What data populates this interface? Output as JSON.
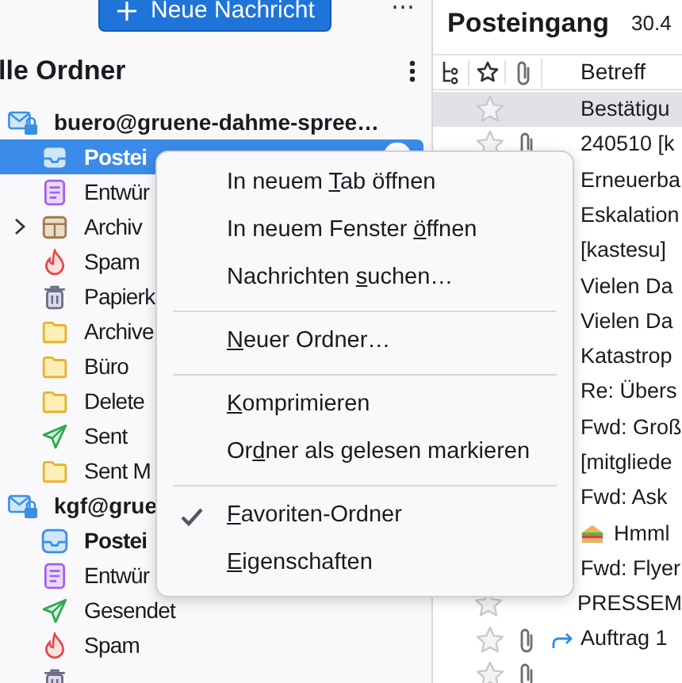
{
  "toolbar": {
    "new_message_button": "Neue Nachricht",
    "more_button": "⋯"
  },
  "folder_pane": {
    "title": "lle Ordner",
    "accounts": [
      {
        "name": "buero@gruene-dahme-spree…",
        "folders": [
          {
            "kind": "inbox",
            "name": "Postei",
            "selected": true,
            "bold": true,
            "expandable": false
          },
          {
            "kind": "drafts",
            "name": "Entwür",
            "selected": false,
            "bold": false,
            "expandable": false
          },
          {
            "kind": "archive",
            "name": "Archiv",
            "selected": false,
            "bold": false,
            "expandable": true
          },
          {
            "kind": "spam",
            "name": "Spam",
            "selected": false,
            "bold": false,
            "expandable": false
          },
          {
            "kind": "trash",
            "name": "Papierk",
            "selected": false,
            "bold": false,
            "expandable": false
          },
          {
            "kind": "folder",
            "name": "Archive",
            "selected": false,
            "bold": false,
            "expandable": false
          },
          {
            "kind": "folder",
            "name": "Büro",
            "selected": false,
            "bold": false,
            "expandable": false
          },
          {
            "kind": "folder",
            "name": "Delete",
            "selected": false,
            "bold": false,
            "expandable": false
          },
          {
            "kind": "sent",
            "name": "Sent",
            "selected": false,
            "bold": false,
            "expandable": false
          },
          {
            "kind": "folder",
            "name": "Sent M",
            "selected": false,
            "bold": false,
            "expandable": false
          }
        ]
      },
      {
        "name": "kgf@grue",
        "folders": [
          {
            "kind": "inbox",
            "name": "Postei",
            "selected": false,
            "bold": true,
            "expandable": false
          },
          {
            "kind": "drafts",
            "name": "Entwür",
            "selected": false,
            "bold": false,
            "expandable": false
          },
          {
            "kind": "sent",
            "name": "Gesendet",
            "selected": false,
            "bold": false,
            "expandable": false
          },
          {
            "kind": "spam",
            "name": "Spam",
            "selected": false,
            "bold": false,
            "expandable": false
          },
          {
            "kind": "trash",
            "selected": false
          }
        ]
      }
    ]
  },
  "message_list": {
    "title": "Posteingang",
    "count": "30.4",
    "columns": {
      "subject": "Betreff"
    },
    "rows": [
      {
        "subject": "Bestätigu",
        "selected": true,
        "attachment": false,
        "replied": false,
        "emoji": false
      },
      {
        "subject": "240510 [k",
        "selected": false,
        "attachment": true,
        "replied": false,
        "emoji": false
      },
      {
        "subject": "Erneuerba",
        "selected": false,
        "emoji": false
      },
      {
        "subject": "Eskalation",
        "selected": false,
        "emoji": false
      },
      {
        "subject": "[kastesu]",
        "selected": false,
        "emoji": false
      },
      {
        "subject": "Vielen Da",
        "selected": false,
        "emoji": false
      },
      {
        "subject": "Vielen Da",
        "selected": false,
        "emoji": false
      },
      {
        "subject": "Katastrop",
        "selected": false,
        "emoji": false
      },
      {
        "subject": "Re: Übers",
        "selected": false,
        "emoji": false
      },
      {
        "subject": "Fwd: Groß",
        "selected": false,
        "emoji": false
      },
      {
        "subject": "[mitgliede",
        "selected": false,
        "emoji": false
      },
      {
        "subject": "Fwd: Ask",
        "selected": false,
        "emoji": false
      },
      {
        "subject": "Hmml",
        "selected": false,
        "emoji": true
      },
      {
        "subject": "Fwd: Flyer",
        "selected": false,
        "emoji": false
      },
      {
        "subject": "PRESSEM",
        "selected": false,
        "attachment": false,
        "replied": false,
        "emoji": false
      },
      {
        "subject": "Auftrag 1",
        "selected": false,
        "attachment": true,
        "replied": true,
        "emoji": false
      },
      {
        "selected": false,
        "attachment": true,
        "replied": false,
        "emoji": false
      }
    ]
  },
  "context_menu": [
    {
      "kind": "item",
      "before": "In neuem ",
      "key": "T",
      "after": "ab öffnen",
      "checked": false
    },
    {
      "kind": "item",
      "before": "In neuem Fenster ",
      "key": "ö",
      "after": "ffnen",
      "checked": false
    },
    {
      "kind": "item",
      "before": "Nachrichten ",
      "key": "s",
      "after": "uchen…",
      "checked": false
    },
    {
      "kind": "separator"
    },
    {
      "kind": "item",
      "key": "N",
      "after": "euer Ordner…",
      "checked": false
    },
    {
      "kind": "separator"
    },
    {
      "kind": "item",
      "key": "K",
      "after": "omprimieren",
      "checked": false
    },
    {
      "kind": "item",
      "before": "Or",
      "key": "d",
      "after": "ner als gelesen markieren",
      "checked": false
    },
    {
      "kind": "separator"
    },
    {
      "kind": "item",
      "key": "F",
      "after": "avoriten-Ordner",
      "checked": true
    },
    {
      "kind": "item",
      "key": "E",
      "after": "igenschaften",
      "checked": false
    }
  ]
}
